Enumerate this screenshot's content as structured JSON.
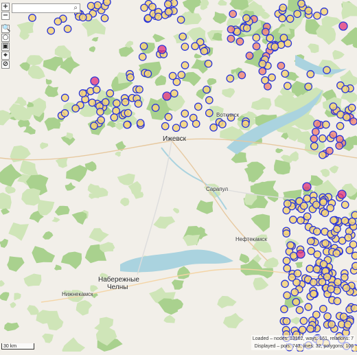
{
  "search": {
    "placeholder": "",
    "icon": "search-icon"
  },
  "toolbar": {
    "zoom_in": "+",
    "zoom_out": "−",
    "tools": [
      "🔍",
      "○",
      "▣",
      "⌖",
      "⊘"
    ]
  },
  "cities": {
    "izhevsk": "Ижевск",
    "votkinsk": "Воткинск",
    "sarapul": "Сарапул",
    "neftekamsk": "Нефтекамск",
    "chelny_1": "Набережные",
    "chelny_2": "Челны",
    "nizhnekamsk": "Нижнекамск"
  },
  "scale": {
    "label": "30 km"
  },
  "stats": {
    "loaded": "Loaded – nodes: 13162, ways: 161, relations: 7",
    "displayed": "Displayed – pois: 743, lines: 32, polygons: 106"
  },
  "colors": {
    "background": "#f2efe9",
    "forest": "#cfe5b8",
    "forest_dense": "#a9d18e",
    "water": "#aad3df",
    "marker_fill": "#f5d37a",
    "marker_stroke": "#2a35d8",
    "marker_hot": "#e0327a"
  }
}
